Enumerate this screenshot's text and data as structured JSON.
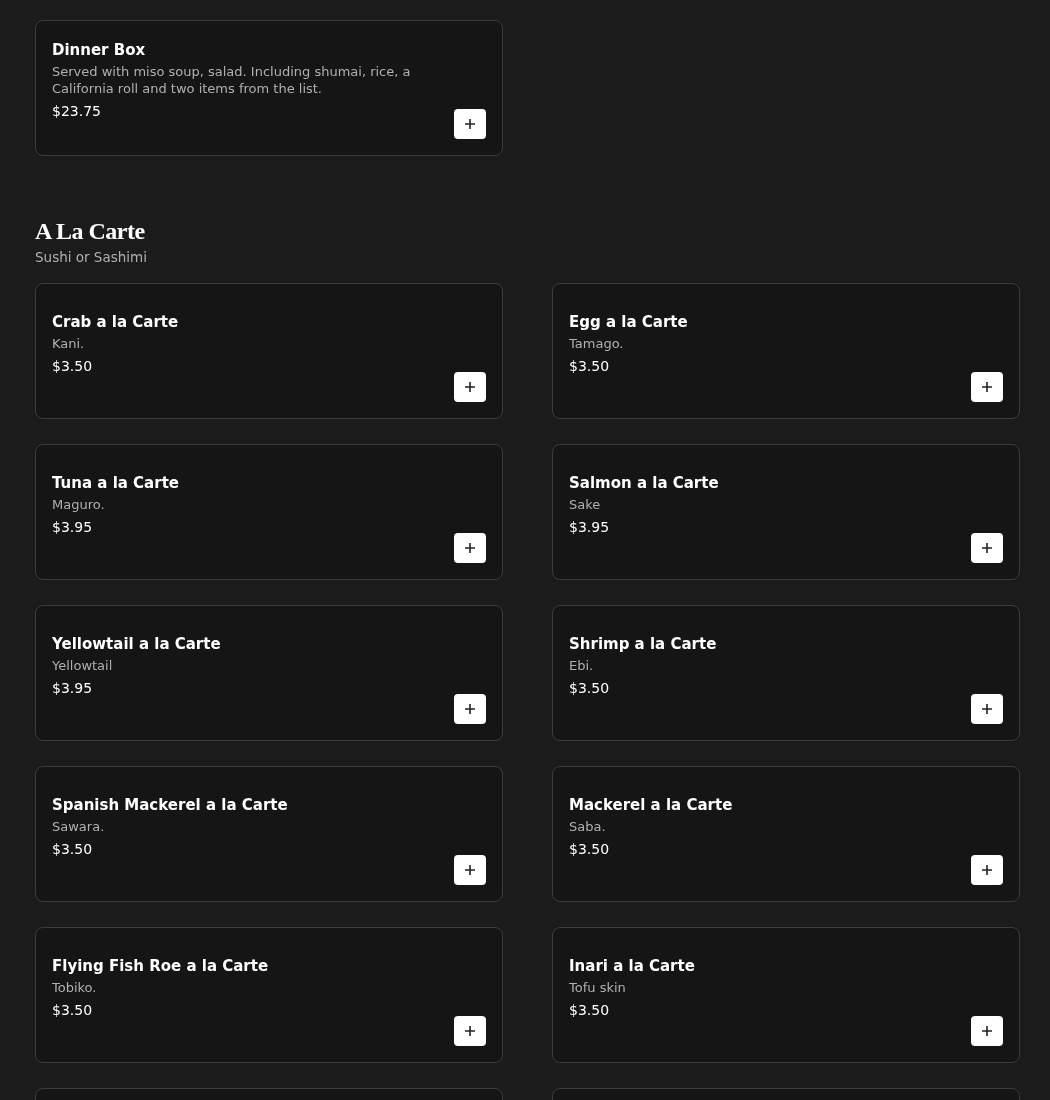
{
  "top_items": [
    {
      "name": "Dinner Box",
      "description": "Served with miso soup, salad. Including shumai, rice, a California roll and two items from the list.",
      "price": "$23.75"
    }
  ],
  "section": {
    "title": "A La Carte",
    "subtitle": "Sushi or Sashimi"
  },
  "items": [
    {
      "name": "Crab a la Carte",
      "description": "Kani.",
      "price": "$3.50"
    },
    {
      "name": "Egg a la Carte",
      "description": "Tamago.",
      "price": "$3.50"
    },
    {
      "name": "Tuna a la Carte",
      "description": "Maguro.",
      "price": "$3.95"
    },
    {
      "name": "Salmon a la Carte",
      "description": "Sake",
      "price": "$3.95"
    },
    {
      "name": "Yellowtail a la Carte",
      "description": "Yellowtail",
      "price": "$3.95"
    },
    {
      "name": "Shrimp a la Carte",
      "description": "Ebi.",
      "price": "$3.50"
    },
    {
      "name": "Spanish Mackerel a la Carte",
      "description": "Sawara.",
      "price": "$3.50"
    },
    {
      "name": "Mackerel a la Carte",
      "description": "Saba.",
      "price": "$3.50"
    },
    {
      "name": "Flying Fish Roe a la Carte",
      "description": "Tobiko.",
      "price": "$3.50"
    },
    {
      "name": "Inari a la Carte",
      "description": "Tofu skin",
      "price": "$3.50"
    }
  ],
  "cut_off_items": [
    {
      "kind": "card"
    },
    {
      "kind": "card"
    }
  ]
}
